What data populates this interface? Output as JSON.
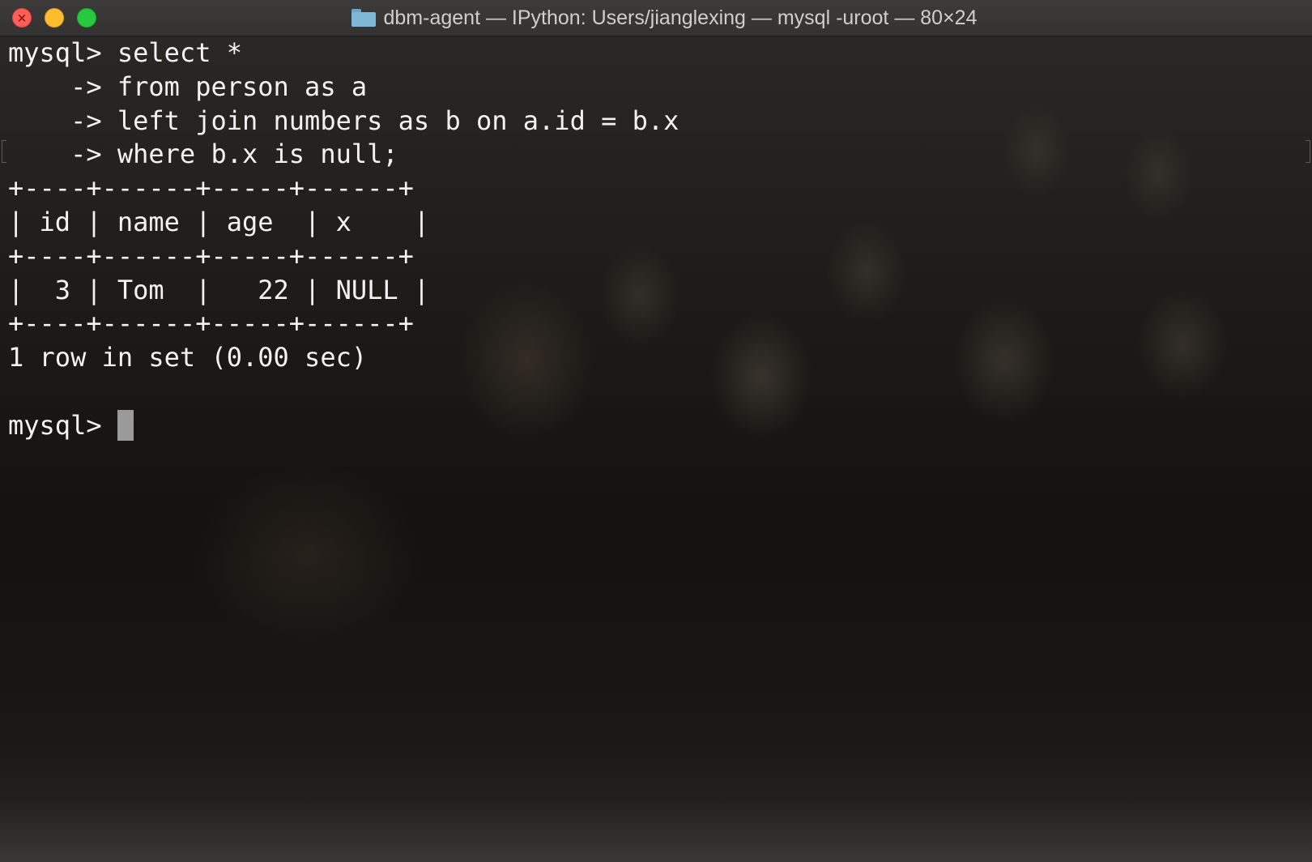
{
  "window": {
    "title": "dbm-agent — IPython: Users/jianglexing — mysql -uroot — 80×24",
    "controls": [
      "close",
      "minimize",
      "zoom"
    ],
    "colors": {
      "close": "#ff5f57",
      "minimize": "#febc2e",
      "zoom": "#28c840",
      "text": "#f2f2f2",
      "cursor": "#9a9a9a"
    }
  },
  "terminal": {
    "lines": [
      "mysql> select *",
      "    -> from person as a",
      "    -> left join numbers as b on a.id = b.x",
      "    -> where b.x is null;",
      "+----+------+-----+------+",
      "| id | name | age  | x    |",
      "+----+------+-----+------+",
      "|  3 | Tom  |   22 | NULL |",
      "+----+------+-----+------+",
      "1 row in set (0.00 sec)",
      "",
      "mysql> "
    ],
    "result_table": {
      "columns": [
        "id",
        "name",
        "age",
        "x"
      ],
      "rows": [
        [
          "3",
          "Tom",
          "22",
          "NULL"
        ]
      ]
    }
  }
}
